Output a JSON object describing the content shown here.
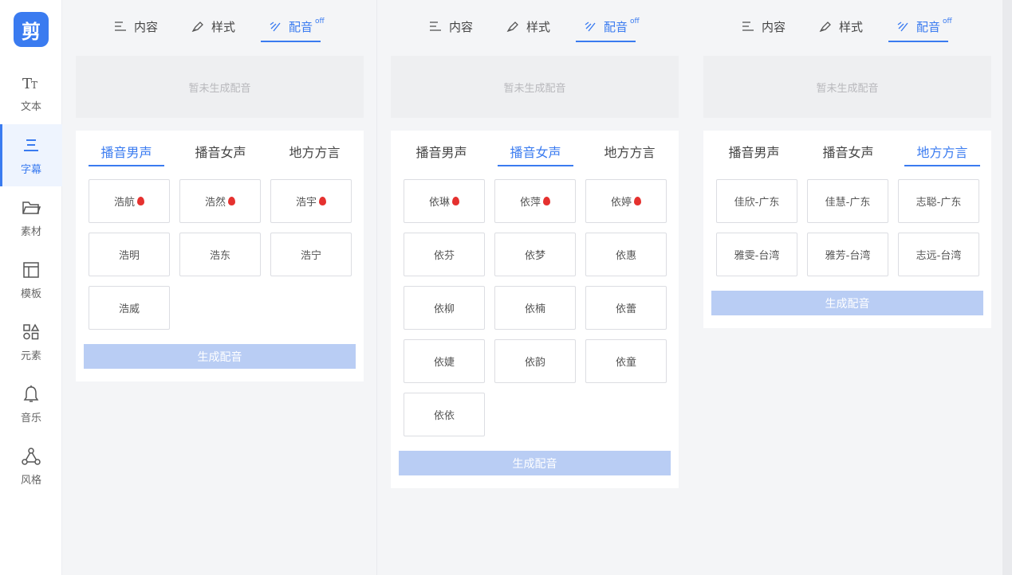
{
  "app": {
    "logo_text": "剪",
    "brand_color": "#3a7bf0"
  },
  "sidebar": {
    "items": [
      {
        "label": "文本",
        "icon": "text-size-icon"
      },
      {
        "label": "字幕",
        "icon": "subtitle-lines-icon",
        "active": true
      },
      {
        "label": "素材",
        "icon": "folder-icon"
      },
      {
        "label": "模板",
        "icon": "template-icon"
      },
      {
        "label": "元素",
        "icon": "shapes-icon"
      },
      {
        "label": "音乐",
        "icon": "bell-icon"
      },
      {
        "label": "风格",
        "icon": "style-nodes-icon"
      }
    ]
  },
  "panels": [
    {
      "top_tabs": {
        "content": "内容",
        "style": "样式",
        "dub": "配音",
        "dub_badge": "off"
      },
      "status": "暂未生成配音",
      "voice_tabs": [
        "播音男声",
        "播音女声",
        "地方方言"
      ],
      "active_voice_tab": 0,
      "voices": [
        {
          "name": "浩航",
          "hot": true
        },
        {
          "name": "浩然",
          "hot": true
        },
        {
          "name": "浩宇",
          "hot": true
        },
        {
          "name": "浩明",
          "hot": false
        },
        {
          "name": "浩东",
          "hot": false
        },
        {
          "name": "浩宁",
          "hot": false
        },
        {
          "name": "浩威",
          "hot": false
        }
      ],
      "generate_label": "生成配音"
    },
    {
      "top_tabs": {
        "content": "内容",
        "style": "样式",
        "dub": "配音",
        "dub_badge": "off"
      },
      "status": "暂未生成配音",
      "voice_tabs": [
        "播音男声",
        "播音女声",
        "地方方言"
      ],
      "active_voice_tab": 1,
      "voices": [
        {
          "name": "依琳",
          "hot": true
        },
        {
          "name": "依萍",
          "hot": true
        },
        {
          "name": "依婷",
          "hot": true
        },
        {
          "name": "依芬",
          "hot": false
        },
        {
          "name": "依梦",
          "hot": false
        },
        {
          "name": "依惠",
          "hot": false
        },
        {
          "name": "依柳",
          "hot": false
        },
        {
          "name": "依楠",
          "hot": false
        },
        {
          "name": "依蕾",
          "hot": false
        },
        {
          "name": "依婕",
          "hot": false
        },
        {
          "name": "依韵",
          "hot": false
        },
        {
          "name": "依童",
          "hot": false
        },
        {
          "name": "依依",
          "hot": false
        }
      ],
      "generate_label": "生成配音"
    },
    {
      "top_tabs": {
        "content": "内容",
        "style": "样式",
        "dub": "配音",
        "dub_badge": "off"
      },
      "status": "暂未生成配音",
      "voice_tabs": [
        "播音男声",
        "播音女声",
        "地方方言"
      ],
      "active_voice_tab": 2,
      "voices": [
        {
          "name": "佳欣-广东",
          "hot": false
        },
        {
          "name": "佳慧-广东",
          "hot": false
        },
        {
          "name": "志聪-广东",
          "hot": false
        },
        {
          "name": "雅雯-台湾",
          "hot": false
        },
        {
          "name": "雅芳-台湾",
          "hot": false
        },
        {
          "name": "志远-台湾",
          "hot": false
        }
      ],
      "generate_label": "生成配音"
    }
  ]
}
